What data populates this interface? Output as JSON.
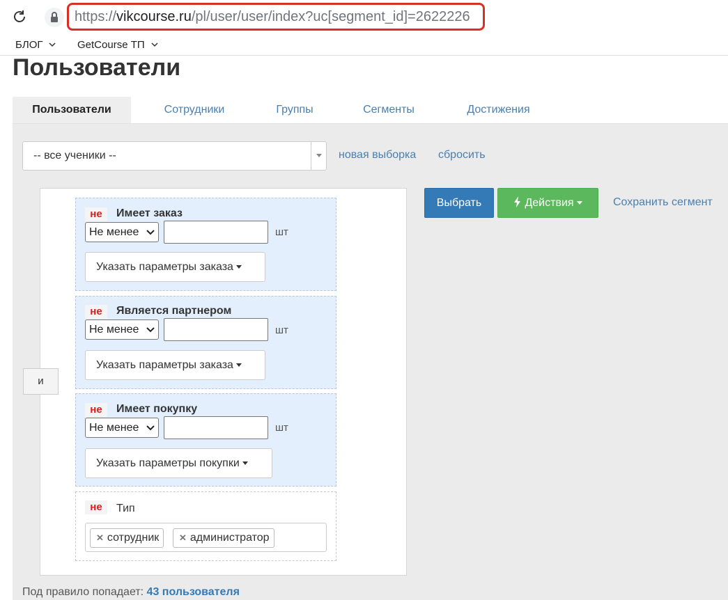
{
  "browser": {
    "url_prefix": "https://",
    "url_domain": "vikcourse.ru",
    "url_path": "/pl/user/user/index?uc[segment_id]=2622226",
    "bookmarks": [
      {
        "label": "БЛОГ"
      },
      {
        "label": "GetCourse ТП"
      }
    ]
  },
  "page": {
    "title": "Пользователи",
    "tabs": [
      {
        "label": "Пользователи"
      },
      {
        "label": "Сотрудники"
      },
      {
        "label": "Группы"
      },
      {
        "label": "Сегменты"
      },
      {
        "label": "Достижения"
      }
    ]
  },
  "filter": {
    "segment_value": "-- все ученики --",
    "new_selection": "новая выборка",
    "reset": "сбросить",
    "and_label": "и",
    "conditions": [
      {
        "negation": "не",
        "title": "Имеет заказ",
        "operator": "Не менее",
        "unit": "шт",
        "params": "Указать параметры заказа"
      },
      {
        "negation": "не",
        "title": "Является партнером",
        "operator": "Не менее",
        "unit": "шт",
        "params": "Указать параметры заказа"
      },
      {
        "negation": "не",
        "title": "Имеет покупку",
        "operator": "Не менее",
        "unit": "шт",
        "params": "Указать параметры покупки"
      },
      {
        "negation": "не",
        "title": "Тип",
        "tags": [
          "сотрудник",
          "администратор"
        ]
      }
    ]
  },
  "actions": {
    "select": "Выбрать",
    "actions": "Действия",
    "save_segment": "Сохранить сегмент"
  },
  "footer": {
    "text": "Под правило попадает:",
    "count": "43 пользователя"
  }
}
